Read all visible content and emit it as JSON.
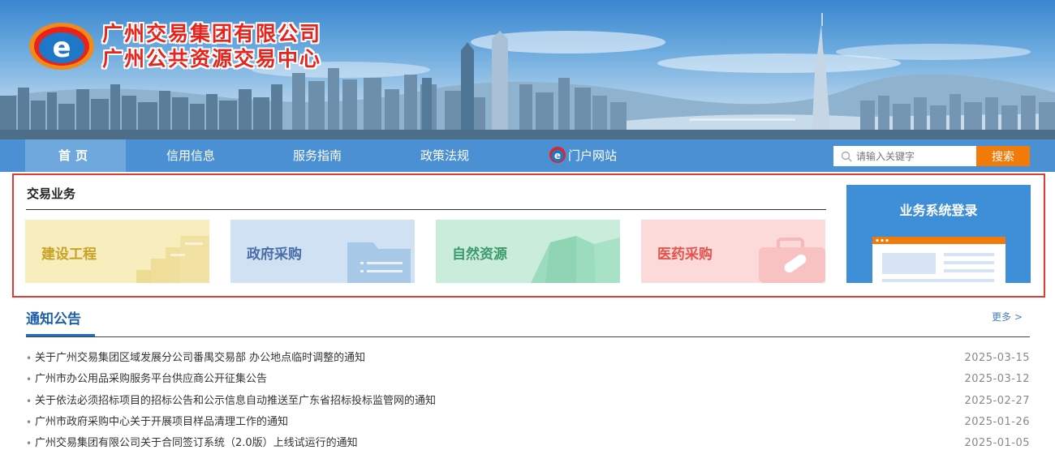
{
  "header": {
    "line1": "广州交易集团有限公司",
    "line2": "广州公共资源交易中心",
    "logo_icon": "e-logo-icon"
  },
  "nav": {
    "items": [
      {
        "label": "首页"
      },
      {
        "label": "信用信息"
      },
      {
        "label": "服务指南"
      },
      {
        "label": "政策法规"
      },
      {
        "label": "门户网站"
      }
    ],
    "active_index": 0
  },
  "search": {
    "placeholder": "请输入关键字",
    "button_label": "搜索"
  },
  "business": {
    "title": "交易业务",
    "cards": [
      {
        "label": "建设工程",
        "color": "#c9a227",
        "bg": "#f8edbc"
      },
      {
        "label": "政府采购",
        "color": "#4a6ea8",
        "bg": "#cfe1f2"
      },
      {
        "label": "自然资源",
        "color": "#3c9a6b",
        "bg": "#c9ecdb"
      },
      {
        "label": "医药采购",
        "color": "#e4544e",
        "bg": "#fddada"
      }
    ],
    "login_title": "业务系统登录"
  },
  "notices": {
    "title": "通知公告",
    "more_label": "更多 >",
    "items": [
      {
        "text": "关于广州交易集团区域发展分公司番禺交易部 办公地点临时调整的通知",
        "date": "2025-03-15"
      },
      {
        "text": "广州市办公用品采购服务平台供应商公开征集公告",
        "date": "2025-03-12"
      },
      {
        "text": "关于依法必须招标项目的招标公告和公示信息自动推送至广东省招标投标监管网的通知",
        "date": "2025-02-27"
      },
      {
        "text": "广州市政府采购中心关于开展项目样品清理工作的通知",
        "date": "2025-01-26"
      },
      {
        "text": "广州交易集团有限公司关于合同签订系统（2.0版）上线试运行的通知",
        "date": "2025-01-05"
      }
    ]
  },
  "colors": {
    "nav_bg": "#4a90d3",
    "accent_orange": "#f27a09",
    "brand_red": "#e8231c",
    "highlight_border": "#e53935"
  }
}
